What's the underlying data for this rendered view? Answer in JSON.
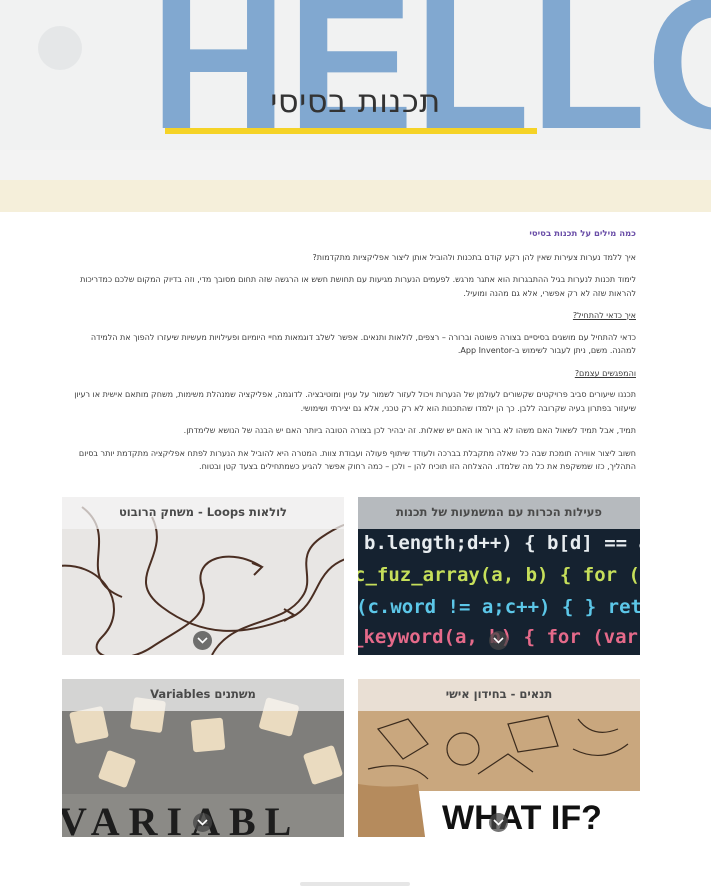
{
  "hero": {
    "background_word": "HELLO",
    "title": "תכנות בסיסי",
    "accent_color": "#f5d327"
  },
  "article": {
    "heading": "כמה מילים על תכנות בסיסי",
    "paragraphs": [
      "איך ללמד נערות צעירות שאין להן רקע קודם בתכנות ולהוביל אותן ליצור אפליקציות מתקדמות?",
      "לימוד תכנות לנערות בגיל ההתבגרות הוא אתגר מרגש. לפעמים הנערות מגיעות עם תחושת חשש או הרגשה שזה תחום מסובך מדי, וזה בדיוק המקום שלכם כמדריכות להראות שזה לא רק אפשרי, אלא גם מהנה ומועיל.",
      "איך כדאי להתחיל?",
      "כדאי להתחיל עם מושגים בסיסיים בצורה פשוטה וברורה – רצפים, לולאות ותנאים. אפשר לשלב דוגמאות מחיי היומיום ופעילויות מעשיות שיעזרו להפוך את הלמידה למהנה. משם, ניתן לעבור לשימוש ב-App Inventor.",
      "והמפגשים עצמם?",
      "תכננו שיעורים סביב פרויקטים שקשורים לעולמן של הנערות ויכול לעזור לשמור על עניין ומוטיבציה. לדוגמה, אפליקציה שמנהלת משימות, משחק מותאם אישית או רעיון שיעזור בפתרון בעיה שקרובה ללבן. כך הן ילמדו שהתכנות הוא לא רק טכני, אלא גם יצירתי ושימושי.",
      "תמיד, אבל תמיד לשאול האם משהו לא ברור או האם יש שאלות. זה יבהיר לכן בצורה הטובה ביותר האם יש הבנה של הנושא שלימדתן.",
      "חשוב ליצור אווירה תומכת שבה כל שאלה מתקבלת בברכה ולעודד שיתוף פעולה ועבודת צוות. המטרה היא להוביל את הנערות לפתח אפליקציה מתקדמת יותר בסיום התהליך, כזו שמשקפת את כל מה שלמדו. ההצלחה הזו תוכיח להן – ולכן – כמה רחוק אפשר להגיע כשמתחילים בצעד קטן ובטוח."
    ],
    "heading_color": "#6b4fa8"
  },
  "cards": [
    {
      "id": "activities",
      "title": "פעילות הכרות עם המשמעות של תכנות",
      "image": "code-screen"
    },
    {
      "id": "loops",
      "title": "לולאות Loops - משחק הרובוט",
      "image": "string-loops"
    },
    {
      "id": "conditions",
      "title": "תנאים - בחידון אישי",
      "image": "what-if-paper"
    },
    {
      "id": "variables",
      "title": "משתנים Variables",
      "image": "wooden-letter-blocks"
    }
  ],
  "card_image_texts": {
    "code_lines": [
      "b.length;d++) { b[d] == a",
      "c_fuz_array(a, b) { for (v",
      "(c.word != a;c++) { } ret",
      "_keyword(a, b) { for (var c"
    ],
    "what_if": "WHAT IF?",
    "blocks": "VARIABL"
  }
}
